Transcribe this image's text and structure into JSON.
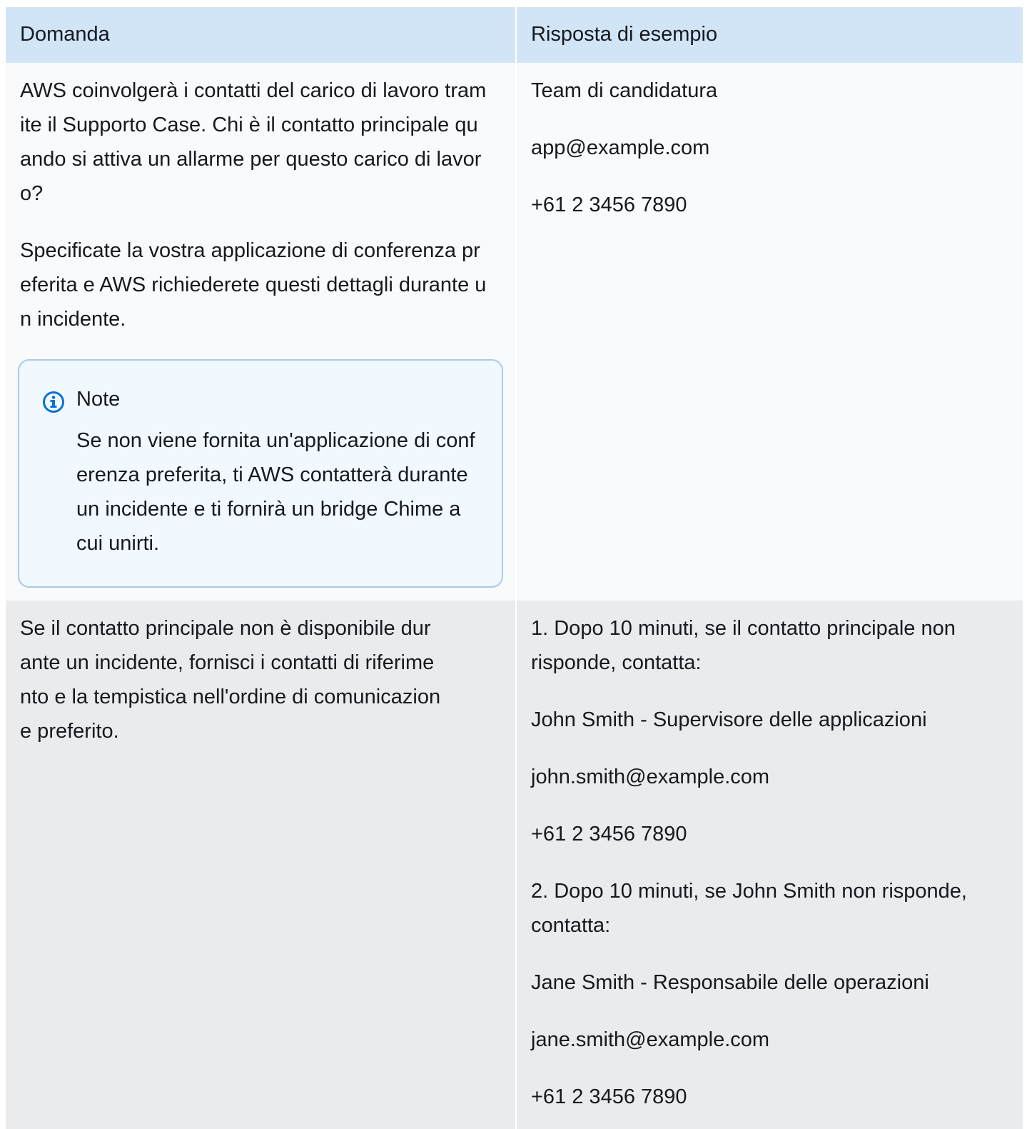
{
  "table": {
    "headers": {
      "question": "Domanda",
      "answer": "Risposta di esempio"
    },
    "row1": {
      "question": {
        "p1": "AWS coinvolgerà i contatti del carico di lavoro tramite il Supporto Case. Chi è il contatto principale quando si attiva un allarme per questo carico di lavoro?",
        "p2": "Specificate la vostra applicazione di conferenza preferita e AWS richiederete questi dettagli durante un incidente.",
        "note": {
          "title": "Note",
          "body": "Se non viene fornita un'applicazione di conferenza preferita, ti AWS contatterà durante un incidente e ti fornirà un bridge Chime a cui unirti.",
          "icon": "info-icon"
        }
      },
      "answer": {
        "lines": [
          "Team di candidatura",
          "app@example.com",
          "+61 2 3456 7890"
        ]
      }
    },
    "row2": {
      "question": "Se il contatto principale non è disponibile durante un incidente, fornisci i contatti di riferimento e la tempistica nell'ordine di comunicazione preferito.",
      "answer": {
        "lines": [
          "1. Dopo 10 minuti, se il contatto principale non risponde, contatta:",
          "John Smith - Supervisore delle applicazioni",
          "john.smith@example.com",
          "+61 2 3456 7890",
          "2. Dopo 10 minuti, se John Smith non risponde, contatta:",
          "Jane Smith - Responsabile delle operazioni",
          "jane.smith@example.com",
          "+61 2 3456 7890"
        ]
      }
    },
    "colors": {
      "header_bg": "#d1e5f7",
      "row1_bg": "#f9fafb",
      "row2_bg": "#eaebed",
      "note_border": "#aacbe8",
      "note_bg": "#f1f8fe",
      "info_icon": "#0972d3"
    }
  }
}
